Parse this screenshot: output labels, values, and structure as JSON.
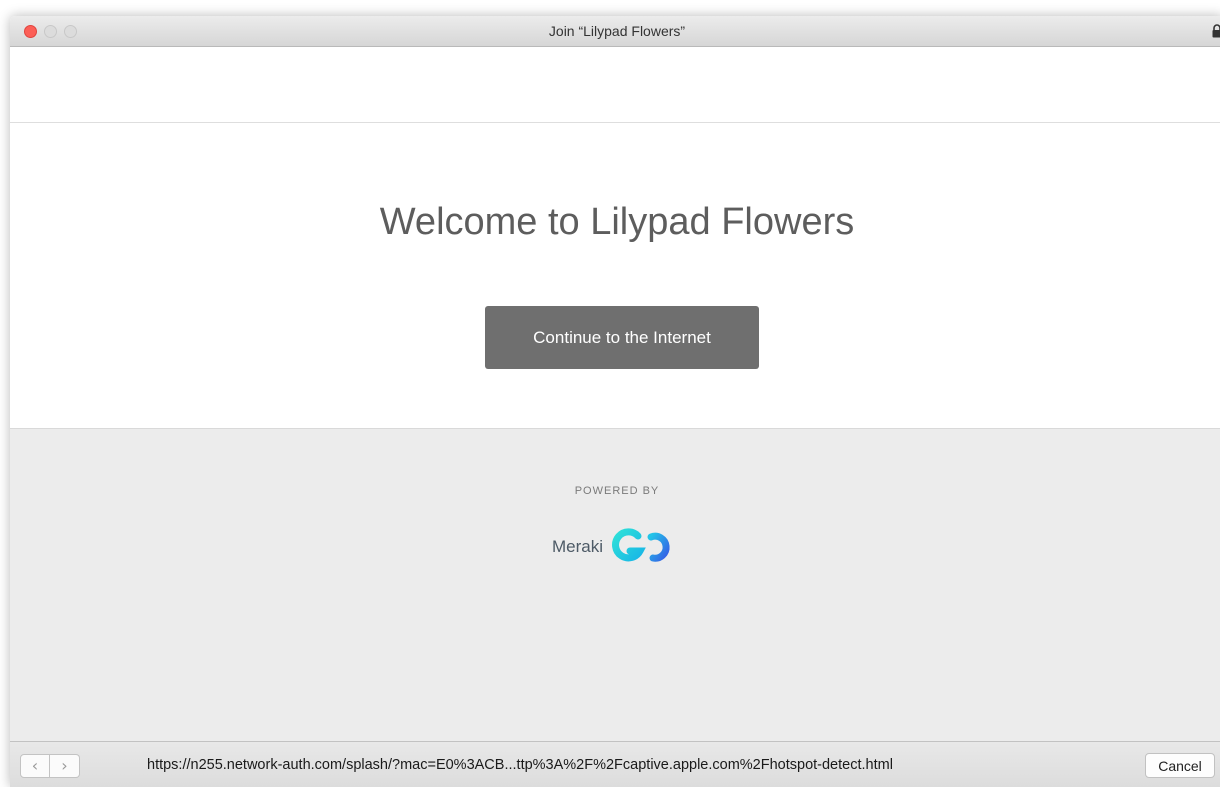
{
  "window": {
    "title": "Join “Lilypad Flowers”"
  },
  "page": {
    "welcome_heading": "Welcome to Lilypad Flowers",
    "continue_label": "Continue to the Internet",
    "powered_by": "POWERED BY",
    "brand_name": "Meraki",
    "brand_mark": "GO"
  },
  "bottom_bar": {
    "back_icon": "chevron-left-icon",
    "forward_icon": "chevron-right-icon",
    "url": "https://n255.network-auth.com/splash/?mac=E0%3ACB...ttp%3A%2F%2Fcaptive.apple.com%2Fhotspot-detect.html",
    "cancel_label": "Cancel"
  },
  "colors": {
    "close_dot": "#fc5f57",
    "button_bg": "#6f6f6f",
    "footer_bg": "#ececec",
    "go_cyan": "#1fc7e0",
    "go_blue": "#2f6fe8"
  }
}
